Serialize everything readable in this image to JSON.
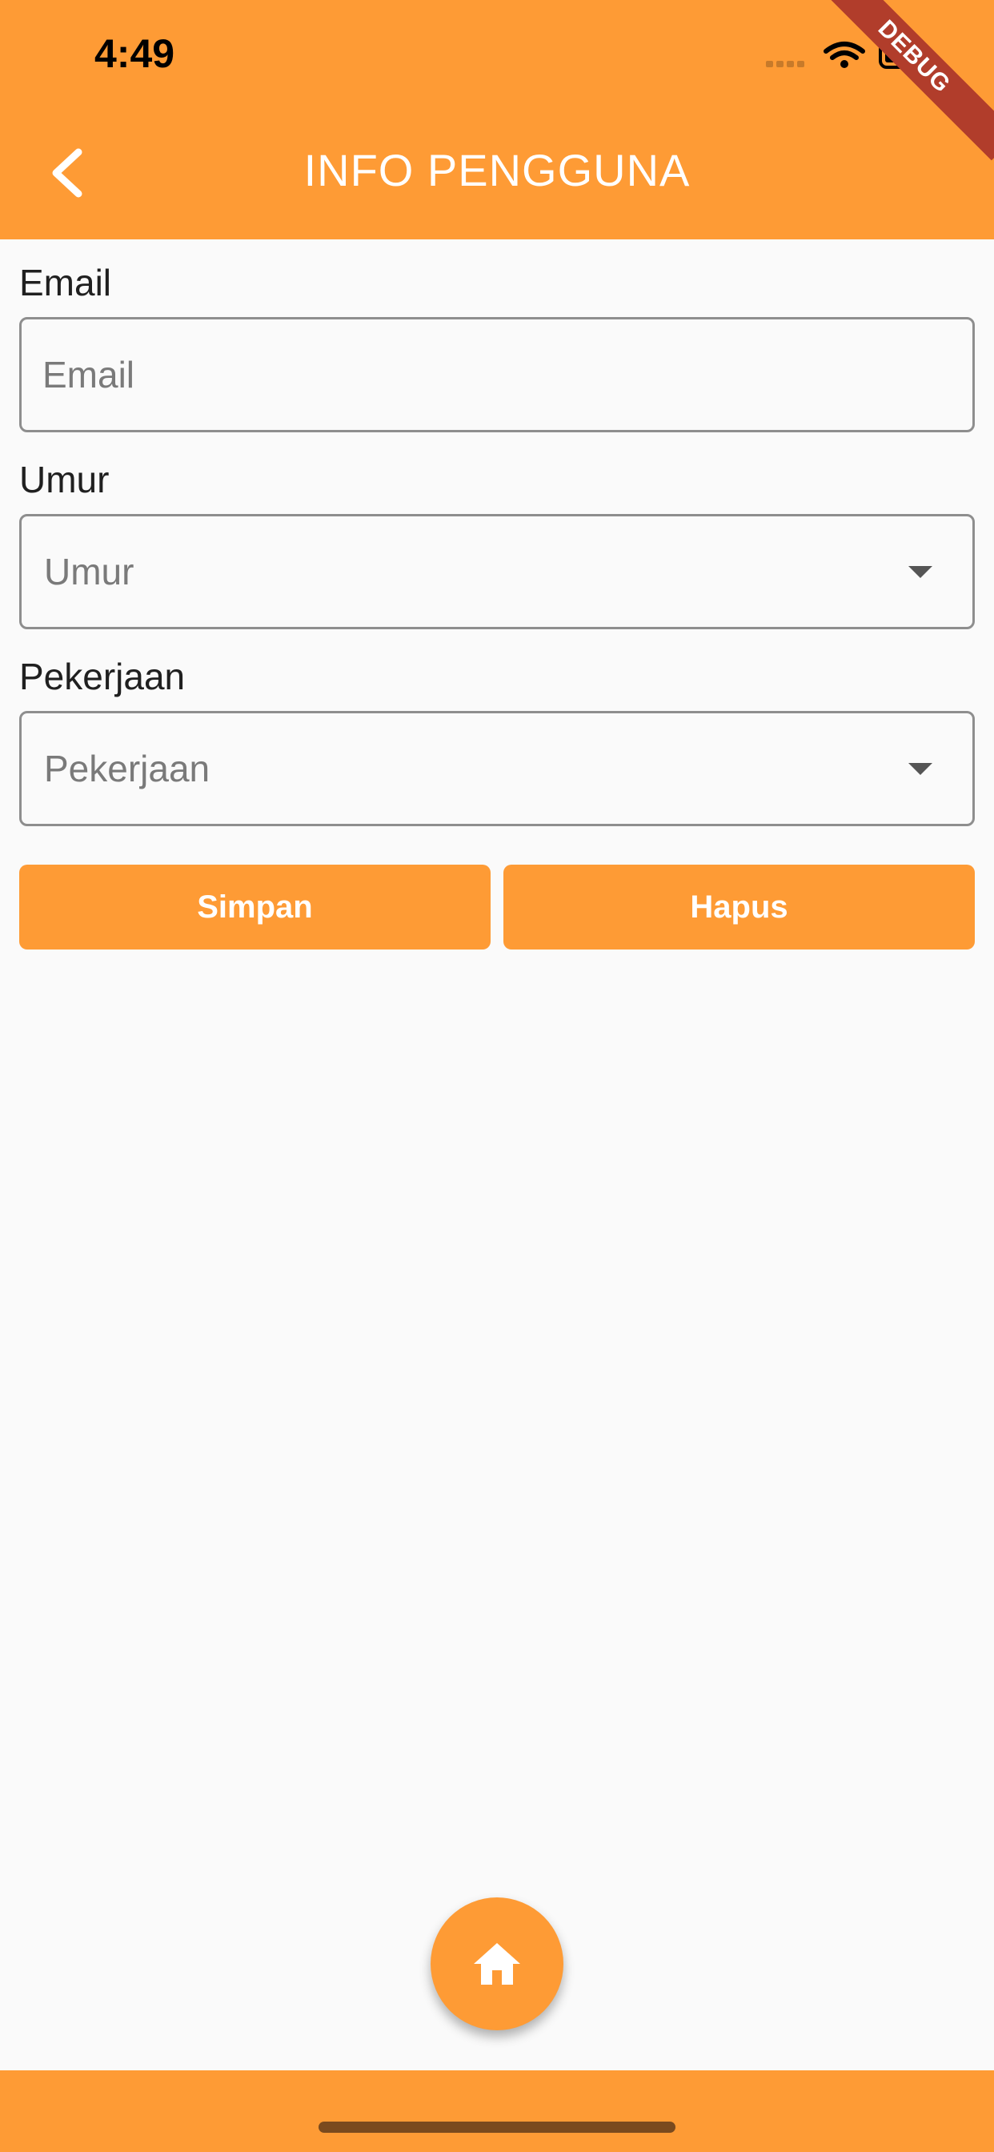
{
  "status_bar": {
    "time": "4:49"
  },
  "app_bar": {
    "title": "INFO PENGGUNA",
    "debug_label": "DEBUG"
  },
  "form": {
    "email": {
      "label": "Email",
      "placeholder": "Email",
      "value": ""
    },
    "age": {
      "label": "Umur",
      "placeholder": "Umur"
    },
    "job": {
      "label": "Pekerjaan",
      "placeholder": "Pekerjaan"
    }
  },
  "actions": {
    "save_label": "Simpan",
    "delete_label": "Hapus"
  },
  "colors": {
    "accent": "#fe9b35",
    "debug": "#b13d2b"
  },
  "icons": {
    "back": "chevron-left-icon",
    "home": "home-icon",
    "dropdown": "caret-down-icon"
  }
}
